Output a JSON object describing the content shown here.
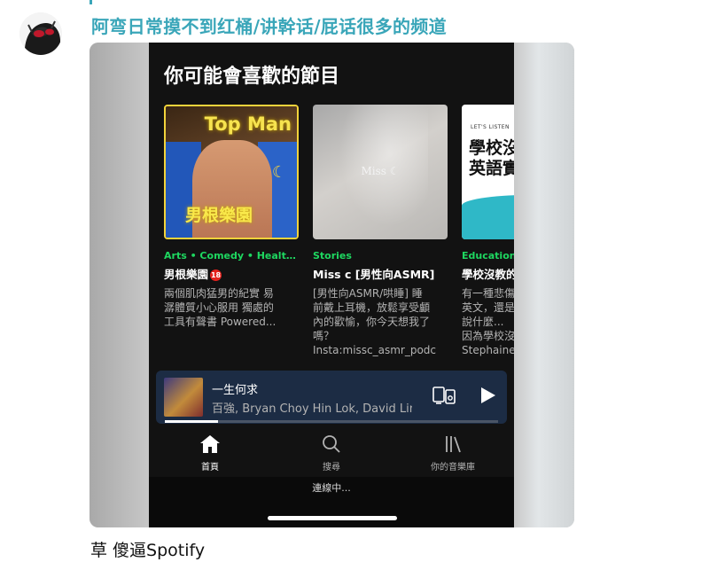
{
  "channel": {
    "title": "阿弯日常摸不到红桶/讲幹话/屁话很多的频道"
  },
  "spotify": {
    "section_title": "你可能會喜歡的節目",
    "shows": [
      {
        "category": "Arts • Comedy • Health &...",
        "name": "男根樂園",
        "badge": "18",
        "description": "兩個肌肉猛男的紀實 易\n潺體質小心服用 獨處的\n工具有聲書  Powered...",
        "art_title": "Top Man",
        "art_subtitle": "男根樂園"
      },
      {
        "category": "Stories",
        "name": "Miss c [男性向ASMR]",
        "description": "[男性向ASMR/哄睡] 睡\n前戴上耳機，放鬆享受顱\n內的歡愉，你今天想我了\n嗎？\nInsta:missc_asmr_podc",
        "art_logo": "Miss ☾"
      },
      {
        "category": "Educational",
        "name": "學校沒教的",
        "description": "有一種悲傷\n英文，還是\n說什麼...\n因為學校沒\nStephaine",
        "art_small": "LET'S LISTEN",
        "art_big_line1": "學校沒",
        "art_big_line2": "英語實"
      }
    ],
    "now_playing": {
      "title": "一生何求",
      "artist": "百強, Bryan Choy Hin Lok, David Lin",
      "progress": 0.16
    },
    "nav": [
      {
        "label": "首頁",
        "icon": "home-icon",
        "active": true
      },
      {
        "label": "搜尋",
        "icon": "search-icon",
        "active": false
      },
      {
        "label": "你的音樂庫",
        "icon": "library-icon",
        "active": false
      }
    ],
    "connection_status": "連線中..."
  },
  "caption": "草 傻逼Spotify"
}
